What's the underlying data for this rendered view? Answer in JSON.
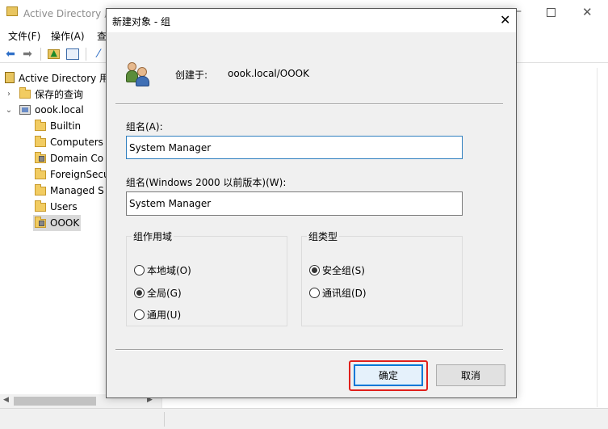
{
  "background_window": {
    "title": "Active Directory 用",
    "menu": [
      "文件(F)",
      "操作(A)",
      "查"
    ],
    "tree": [
      {
        "label": "Active Directory 用",
        "level": "root"
      },
      {
        "label": "保存的查询",
        "level": "child",
        "expander": "›"
      },
      {
        "label": "oook.local",
        "level": "child",
        "expander": "⌄"
      },
      {
        "label": "Builtin",
        "level": "grandchild"
      },
      {
        "label": "Computers",
        "level": "grandchild"
      },
      {
        "label": "Domain Co",
        "level": "grandchild"
      },
      {
        "label": "ForeignSecu",
        "level": "grandchild"
      },
      {
        "label": "Managed S",
        "level": "grandchild"
      },
      {
        "label": "Users",
        "level": "grandchild"
      },
      {
        "label": "OOOK",
        "level": "grandchild",
        "selected": true
      }
    ]
  },
  "dialog": {
    "title": "新建对象 - 组",
    "close_glyph": "✕",
    "created_in_label": "创建于:",
    "created_in_value": "oook.local/OOOK",
    "group_name_label": "组名(A):",
    "group_name_value": "System Manager",
    "group_name_pre2000_label": "组名(Windows 2000 以前版本)(W):",
    "group_name_pre2000_value": "System Manager",
    "scope": {
      "legend": "组作用域",
      "options": [
        {
          "label": "本地域(O)",
          "checked": false
        },
        {
          "label": "全局(G)",
          "checked": true
        },
        {
          "label": "通用(U)",
          "checked": false
        }
      ]
    },
    "type": {
      "legend": "组类型",
      "options": [
        {
          "label": "安全组(S)",
          "checked": true
        },
        {
          "label": "通讯组(D)",
          "checked": false
        }
      ]
    },
    "ok_label": "确定",
    "cancel_label": "取消"
  },
  "colors": {
    "highlight": "#e0201c",
    "focus_blue": "#0078d7",
    "dialog_bg": "#f0f0f0"
  }
}
